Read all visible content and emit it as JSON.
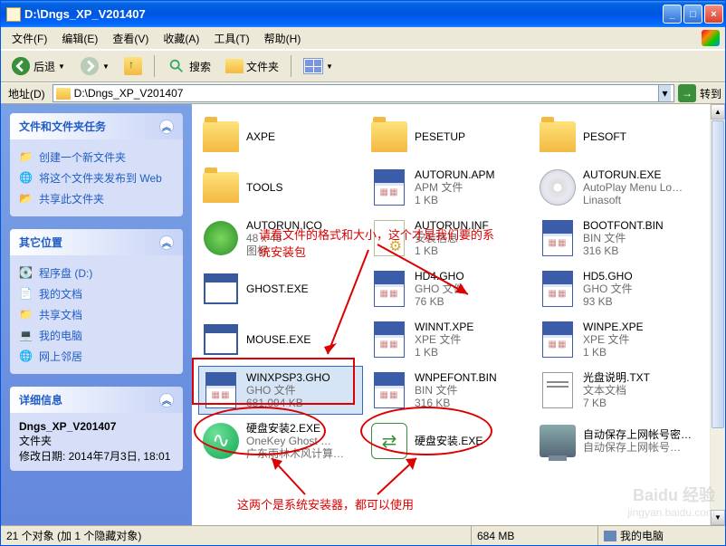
{
  "window": {
    "title": "D:\\Dngs_XP_V201407"
  },
  "win_buttons": {
    "min": "_",
    "max": "□",
    "close": "×"
  },
  "menu": {
    "file": "文件(F)",
    "edit": "编辑(E)",
    "view": "查看(V)",
    "favorites": "收藏(A)",
    "tools": "工具(T)",
    "help": "帮助(H)"
  },
  "toolbar": {
    "back": "后退",
    "search": "搜索",
    "folders": "文件夹"
  },
  "address": {
    "label": "地址(D)",
    "value": "D:\\Dngs_XP_V201407",
    "go": "转到",
    "arrow": "→"
  },
  "sidebar": {
    "tasks": {
      "title": "文件和文件夹任务",
      "items": [
        "创建一个新文件夹",
        "将这个文件夹发布到 Web",
        "共享此文件夹"
      ]
    },
    "places": {
      "title": "其它位置",
      "items": [
        "程序盘 (D:)",
        "我的文档",
        "共享文档",
        "我的电脑",
        "网上邻居"
      ]
    },
    "details": {
      "title": "详细信息",
      "name": "Dngs_XP_V201407",
      "type": "文件夹",
      "mod": "修改日期: 2014年7月3日, 18:01"
    },
    "chev": "︽"
  },
  "files": [
    {
      "icon": "folder",
      "name": "AXPE",
      "l1": "",
      "l2": ""
    },
    {
      "icon": "folder",
      "name": "PESETUP",
      "l1": "",
      "l2": ""
    },
    {
      "icon": "folder",
      "name": "PESOFT",
      "l1": "",
      "l2": ""
    },
    {
      "icon": "folder",
      "name": "TOOLS",
      "l1": "",
      "l2": ""
    },
    {
      "icon": "cal",
      "name": "AUTORUN.APM",
      "l1": "APM 文件",
      "l2": "1 KB"
    },
    {
      "icon": "cd",
      "name": "AUTORUN.EXE",
      "l1": "AutoPlay Menu Lo…",
      "l2": "Linasoft"
    },
    {
      "icon": "ico",
      "name": "AUTORUN.ICO",
      "l1": "48 x 48",
      "l2": "图标"
    },
    {
      "icon": "inf",
      "name": "AUTORUN.INF",
      "l1": "安装信息",
      "l2": "1 KB"
    },
    {
      "icon": "cal",
      "name": "BOOTFONT.BIN",
      "l1": "BIN 文件",
      "l2": "316 KB"
    },
    {
      "icon": "exe",
      "name": "GHOST.EXE",
      "l1": "",
      "l2": ""
    },
    {
      "icon": "cal",
      "name": "HD4.GHO",
      "l1": "GHO 文件",
      "l2": "76 KB"
    },
    {
      "icon": "cal",
      "name": "HD5.GHO",
      "l1": "GHO 文件",
      "l2": "93 KB"
    },
    {
      "icon": "exe",
      "name": "MOUSE.EXE",
      "l1": "",
      "l2": ""
    },
    {
      "icon": "cal",
      "name": "WINNT.XPE",
      "l1": "XPE 文件",
      "l2": "1 KB"
    },
    {
      "icon": "cal",
      "name": "WINPE.XPE",
      "l1": "XPE 文件",
      "l2": "1 KB"
    },
    {
      "icon": "cal",
      "name": "WINXPSP3.GHO",
      "l1": "GHO 文件",
      "l2": "681,094 KB",
      "sel": true
    },
    {
      "icon": "cal",
      "name": "WNPEFONT.BIN",
      "l1": "BIN 文件",
      "l2": "316 KB"
    },
    {
      "icon": "txt",
      "name": "光盘说明.TXT",
      "l1": "文本文档",
      "l2": "7 KB"
    },
    {
      "icon": "green",
      "name": "硬盘安装2.EXE",
      "l1": "OneKey Ghost …",
      "l2": "广东雨林木风计算…"
    },
    {
      "icon": "swap",
      "name": "硬盘安装.EXE",
      "l1": "",
      "l2": ""
    },
    {
      "icon": "comp",
      "name": "自动保存上网帐号密码到U盘.EXE",
      "l1": "自动保存上网帐号…",
      "l2": ""
    }
  ],
  "annotations": {
    "a1": "请看文件的格式和大小，这个才是我们要的系统安装包",
    "a2": "这两个是系统安装器，都可以使用"
  },
  "status": {
    "left": "21 个对象 (加 1 个隐藏对象)",
    "size": "684 MB",
    "location": "我的电脑"
  },
  "scroll": {
    "up": "▲",
    "down": "▼"
  },
  "watermark": {
    "brand": "Baidu 经验",
    "url": "jingyan.baidu.com"
  }
}
